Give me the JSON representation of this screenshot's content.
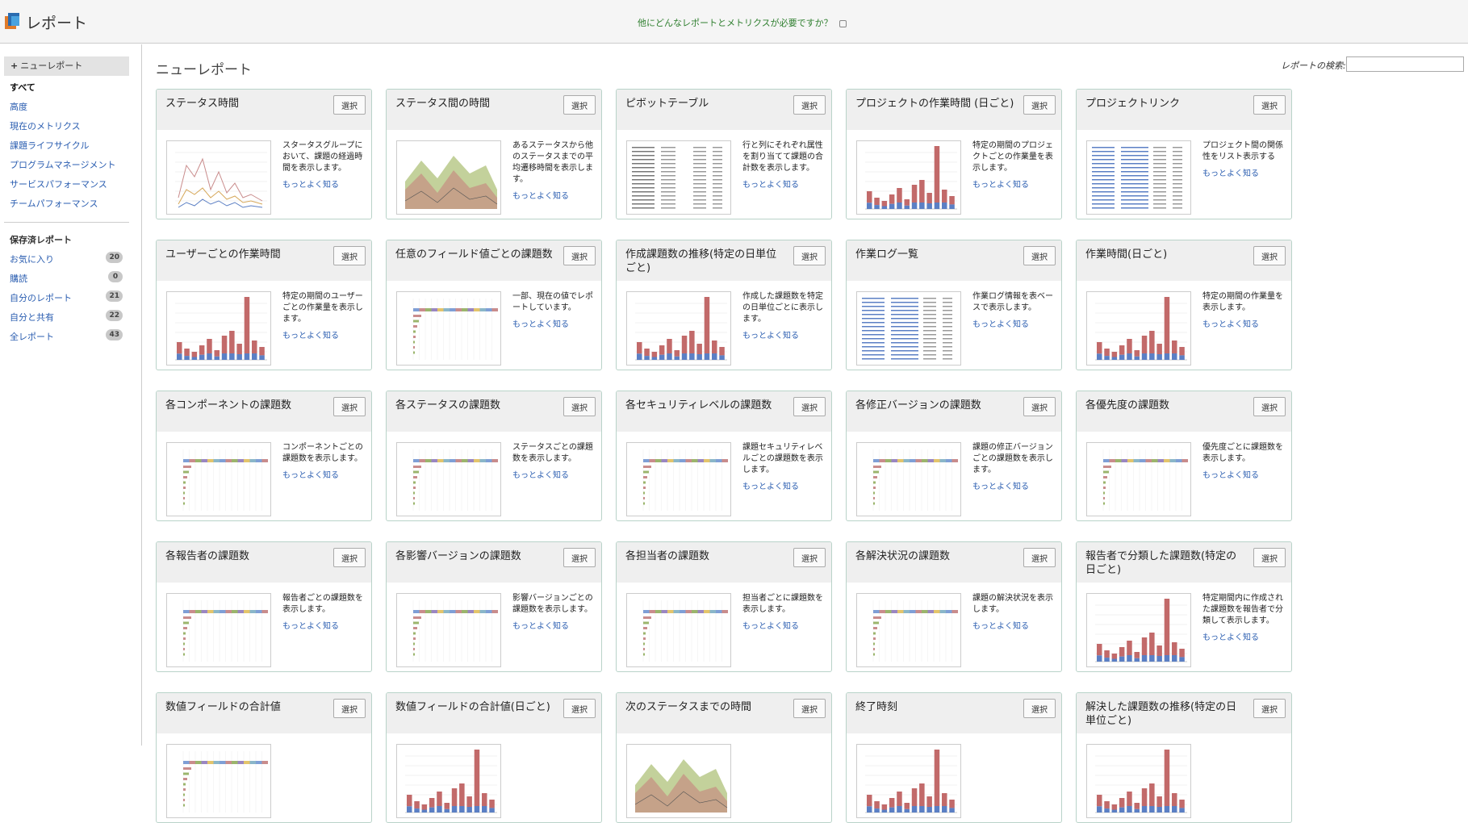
{
  "header": {
    "app_title": "レポート",
    "promo_text": "他にどんなレポートとメトリクスが必要ですか？"
  },
  "sidebar": {
    "new_report": "ニューレポート",
    "all": "すべて",
    "items": [
      "高度",
      "現在のメトリクス",
      "課題ライフサイクル",
      "プログラムマネージメント",
      "サービスパフォーマンス",
      "チームパフォーマンス"
    ],
    "saved_title": "保存済レポート",
    "saved": [
      {
        "label": "お気に入り",
        "count": "20"
      },
      {
        "label": "購読",
        "count": "0"
      },
      {
        "label": "自分のレポート",
        "count": "21"
      },
      {
        "label": "自分と共有",
        "count": "22"
      },
      {
        "label": "全レポート",
        "count": "43"
      }
    ]
  },
  "main": {
    "title": "ニューレポート",
    "search_label": "レポートの検索:",
    "select_label": "選択",
    "more_label": "もっとよく知る",
    "cards": [
      {
        "title": "ステータス時間",
        "desc": "スタータスグループにおいて、課題の経過時間を表示します。",
        "thumb": "line"
      },
      {
        "title": "ステータス間の時間",
        "desc": "あるステータスから他のステータスまでの平均遷移時間を表示します。",
        "thumb": "area"
      },
      {
        "title": "ピボットテーブル",
        "desc": "行と列にそれぞれ属性を割り当てて課題の合計数を表示します。",
        "thumb": "table"
      },
      {
        "title": "プロジェクトの作業時間 (日ごと)",
        "desc": "特定の期間のプロジェクトごとの作業量を表示します。",
        "thumb": "bars"
      },
      {
        "title": "プロジェクトリンク",
        "desc": "プロジェクト間の関係性をリスト表示する",
        "thumb": "list"
      },
      {
        "title": "ユーザーごとの作業時間",
        "desc": "特定の期間のユーザーごとの作業量を表示します。",
        "thumb": "bars"
      },
      {
        "title": "任意のフィールド値ごとの課題数",
        "desc": "一部、現在の値でレポートしています。",
        "thumb": "hbar"
      },
      {
        "title": "作成課題数の推移(特定の日単位ごと)",
        "desc": "作成した課題数を特定の日単位ごとに表示します。",
        "thumb": "bars"
      },
      {
        "title": "作業ログ一覧",
        "desc": "作業ログ情報を表ベースで表示します。",
        "thumb": "list"
      },
      {
        "title": "作業時間(日ごと)",
        "desc": "特定の期間の作業量を表示します。",
        "thumb": "bars"
      },
      {
        "title": "各コンポーネントの課題数",
        "desc": "コンポーネントごとの課題数を表示します。",
        "thumb": "hbar"
      },
      {
        "title": "各ステータスの課題数",
        "desc": "ステータスごとの課題数を表示します。",
        "thumb": "hbar"
      },
      {
        "title": "各セキュリティレベルの課題数",
        "desc": "課題セキュリティレベルごとの課題数を表示します。",
        "thumb": "hbar"
      },
      {
        "title": "各修正バージョンの課題数",
        "desc": "課題の修正バージョンごとの課題数を表示します。",
        "thumb": "hbar"
      },
      {
        "title": "各優先度の課題数",
        "desc": "優先度ごとに課題数を表示します。",
        "thumb": "hbar"
      },
      {
        "title": "各報告者の課題数",
        "desc": "報告者ごとの課題数を表示します。",
        "thumb": "hbar"
      },
      {
        "title": "各影響バージョンの課題数",
        "desc": "影響バージョンごとの課題数を表示します。",
        "thumb": "hbar"
      },
      {
        "title": "各担当者の課題数",
        "desc": "担当者ごとに課題数を表示します。",
        "thumb": "hbar"
      },
      {
        "title": "各解決状況の課題数",
        "desc": "課題の解決状況を表示します。",
        "thumb": "hbar"
      },
      {
        "title": "報告者で分類した課題数(特定の日ごと)",
        "desc": "特定期間内に作成された課題数を報告者で分類して表示します。",
        "thumb": "bars"
      },
      {
        "title": "数値フィールドの合計値",
        "desc": "",
        "thumb": "hbar"
      },
      {
        "title": "数値フィールドの合計値(日ごと)",
        "desc": "",
        "thumb": "bars"
      },
      {
        "title": "次のステータスまでの時間",
        "desc": "",
        "thumb": "area"
      },
      {
        "title": "終了時刻",
        "desc": "",
        "thumb": "bars"
      },
      {
        "title": "解決した課題数の推移(特定の日単位ごと)",
        "desc": "",
        "thumb": "bars"
      }
    ]
  }
}
